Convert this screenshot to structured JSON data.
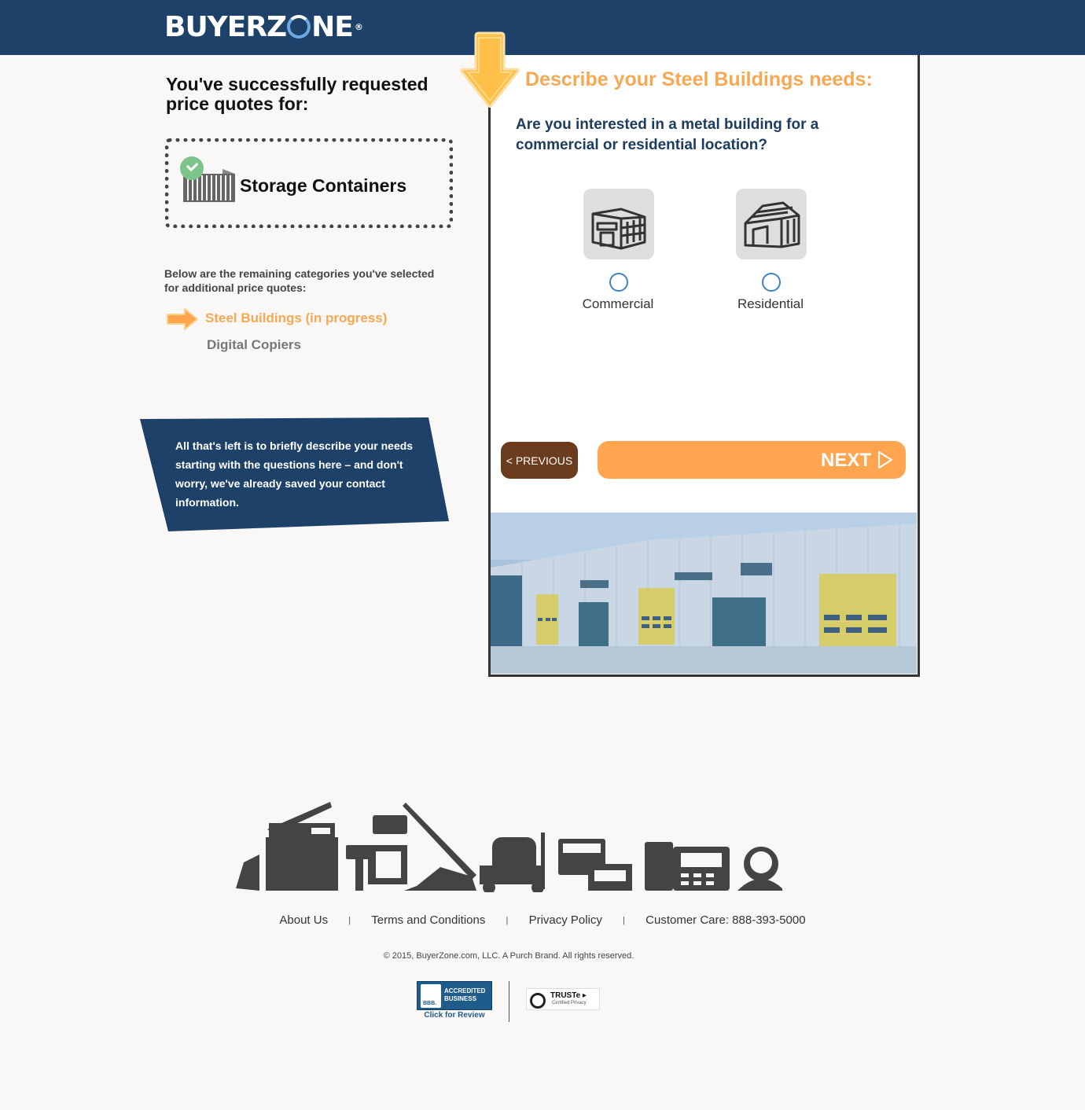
{
  "header": {
    "logo_left": "BUYERZ",
    "logo_right": "NE",
    "logo_reg": "®"
  },
  "left": {
    "success_title": "You've successfully requested price quotes for:",
    "completed_category": "Storage Containers",
    "remaining_text": "Below are the remaining categories you've selected for additional price quotes:",
    "categories": [
      {
        "label": "Steel Buildings (in progress)",
        "status": "in-progress"
      },
      {
        "label": "Digital Copiers",
        "status": "pending"
      }
    ],
    "note": "All that's left is to briefly describe your needs starting with the questions here – and don't worry, we've already saved your contact information."
  },
  "form": {
    "title": "Describe your Steel Buildings needs:",
    "question": "Are you interested in a metal building for a commercial or residential location?",
    "options": [
      {
        "label": "Commercial",
        "icon": "commercial-building-icon"
      },
      {
        "label": "Residential",
        "icon": "residential-building-icon"
      }
    ],
    "previous_label": "< PREVIOUS",
    "next_label": "NEXT"
  },
  "footer": {
    "links": [
      "About Us",
      "Terms and Conditions",
      "Privacy Policy",
      "Customer Care: 888-393-5000"
    ],
    "separator": "|",
    "copyright": "© 2015, BuyerZone.com, LLC. A Purch Brand. All rights reserved.",
    "bbb_label": "ACCREDITED BUSINESS",
    "bbb_seal": "BBB.",
    "bbb_review": "Click for Review",
    "truste_name": "TRUSTe ▸",
    "truste_sub": "Certified Privacy"
  },
  "colors": {
    "header_bg": "#1d4168",
    "accent_orange": "#ffa54f",
    "previous_brown": "#6b3b1d",
    "radio_blue": "#3f82c6"
  }
}
